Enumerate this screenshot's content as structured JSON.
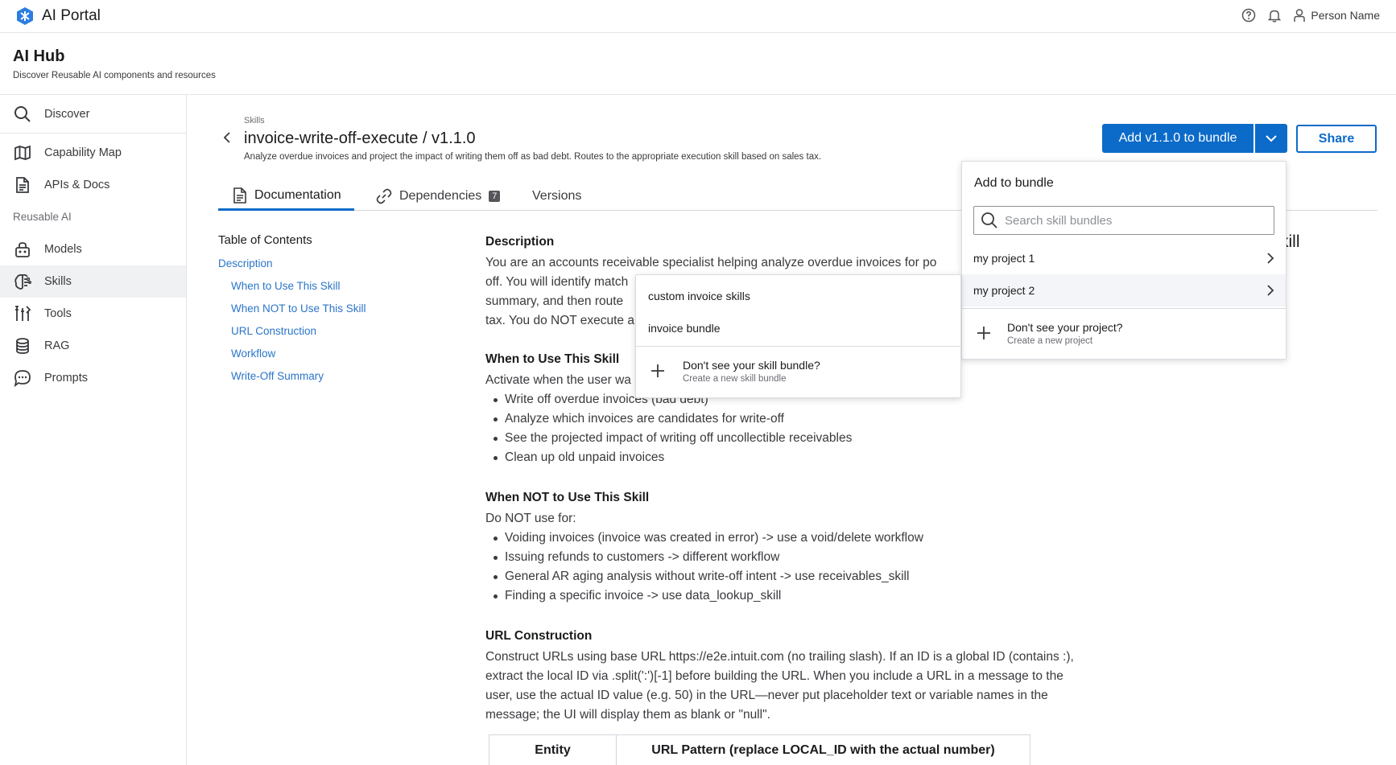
{
  "app": {
    "title": "AI Portal",
    "user_name": "Person Name"
  },
  "hub": {
    "title": "AI Hub",
    "subtitle": "Discover Reusable AI components and resources"
  },
  "sidebar": {
    "items": [
      {
        "label": "Discover",
        "icon": "search-icon"
      },
      {
        "label": "Capability Map",
        "icon": "map-icon"
      },
      {
        "label": "APIs & Docs",
        "icon": "document-icon"
      },
      {
        "label": "Models",
        "icon": "robot-icon"
      },
      {
        "label": "Skills",
        "icon": "brain-icon",
        "active": true
      },
      {
        "label": "Tools",
        "icon": "tools-icon"
      },
      {
        "label": "RAG",
        "icon": "database-icon"
      },
      {
        "label": "Prompts",
        "icon": "chat-icon"
      }
    ],
    "section_label": "Reusable AI"
  },
  "skill": {
    "breadcrumb": "Skills",
    "title": "invoice-write-off-execute / v1.1.0",
    "description": "Analyze overdue invoices and project the impact of writing them off as bad debt. Routes to the appropriate execution skill based on sales tax."
  },
  "actions": {
    "add_label": "Add v1.1.0 to bundle",
    "share_label": "Share"
  },
  "tabs": [
    {
      "label": "Documentation",
      "icon": "document-icon",
      "active": true
    },
    {
      "label": "Dependencies",
      "icon": "link-icon",
      "badge": "7"
    },
    {
      "label": "Versions"
    }
  ],
  "toc": {
    "title": "Table of Contents",
    "items": [
      "Description",
      "When to Use This Skill",
      "When NOT to Use This Skill",
      "URL Construction",
      "Workflow",
      "Write-Off Summary"
    ]
  },
  "doc": {
    "description": {
      "heading": "Description",
      "lines": [
        "You are an accounts receivable specialist helping analyze overdue invoices for po",
        "off. You will identify match",
        "summary, and then route",
        "tax. You do NOT execute a"
      ]
    },
    "when_to_use": {
      "heading": "When to Use This Skill",
      "intro": "Activate when the user wa",
      "bullets": [
        "Write off overdue invoices (bad debt)",
        "Analyze which invoices are candidates for write-off",
        "See the projected impact of writing off uncollectible receivables",
        "Clean up old unpaid invoices"
      ]
    },
    "when_not_to_use": {
      "heading": "When NOT to Use This Skill",
      "intro": "Do NOT use for:",
      "bullets": [
        "Voiding invoices (invoice was created in error) -> use a void/delete workflow",
        "Issuing refunds to customers -> different workflow",
        "General AR aging analysis without write-off intent -> use receivables_skill",
        "Finding a specific invoice -> use data_lookup_skill"
      ]
    },
    "url_construction": {
      "heading": "URL Construction",
      "lines": [
        "Construct URLs using base URL https://e2e.intuit.com (no trailing slash). If an ID is a global ID (contains :),",
        "extract the local ID via .split(':')[-1] before building the URL. When you include a URL in a message to the",
        "user, use the actual ID value (e.g. 50) in the URL—never put placeholder text or variable names in the",
        "message; the UI will display them as blank or \"null\"."
      ]
    },
    "table_headers": [
      "Entity",
      "URL Pattern (replace LOCAL_ID with the actual number)"
    ],
    "background_fragment": "kill"
  },
  "bundle_panel": {
    "title": "Add to bundle",
    "search_placeholder": "Search skill bundles",
    "projects": [
      "my project 1",
      "my project 2"
    ],
    "create_title": "Don't see your project?",
    "create_sub": "Create a new project"
  },
  "bundle_submenu": {
    "items": [
      "custom invoice skills",
      "invoice bundle"
    ],
    "create_title": "Don't see your skill bundle?",
    "create_sub": "Create a new skill bundle"
  },
  "colors": {
    "primary": "#0c6bc9",
    "link": "#2b75c8",
    "text": "#393a3d"
  }
}
